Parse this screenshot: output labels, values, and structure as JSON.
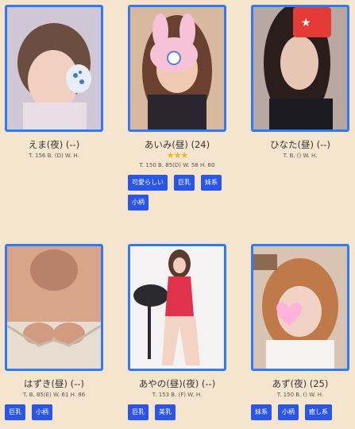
{
  "girls": [
    {
      "name": "えま(夜) (--)",
      "stars": "",
      "sizes": "T. 156 B. (D) W. H.",
      "tags": []
    },
    {
      "name": "あいみ(昼) (24)",
      "stars": "★★★",
      "sizes": "T. 150 B. 85(D) W. 58 H. 80",
      "tags": [
        "可愛らしい",
        "巨乳",
        "妹系",
        "小柄"
      ]
    },
    {
      "name": "ひなた(昼) (--)",
      "stars": "",
      "sizes": "T. B. () W. H.",
      "tags": []
    },
    {
      "name": "はずき(昼) (--)",
      "stars": "",
      "sizes": "T. B. 85(E) W. 61 H. 86",
      "tags": [
        "巨乳",
        "小柄"
      ]
    },
    {
      "name": "あやの(昼)(夜) (--)",
      "stars": "",
      "sizes": "T. 153 B. (F) W. H.",
      "tags": [
        "巨乳",
        "美乳"
      ]
    },
    {
      "name": "あず(夜) (25)",
      "stars": "",
      "sizes": "T. 150 B. () W. H.",
      "tags": [
        "妹系",
        "小柄",
        "癒し系"
      ]
    }
  ]
}
